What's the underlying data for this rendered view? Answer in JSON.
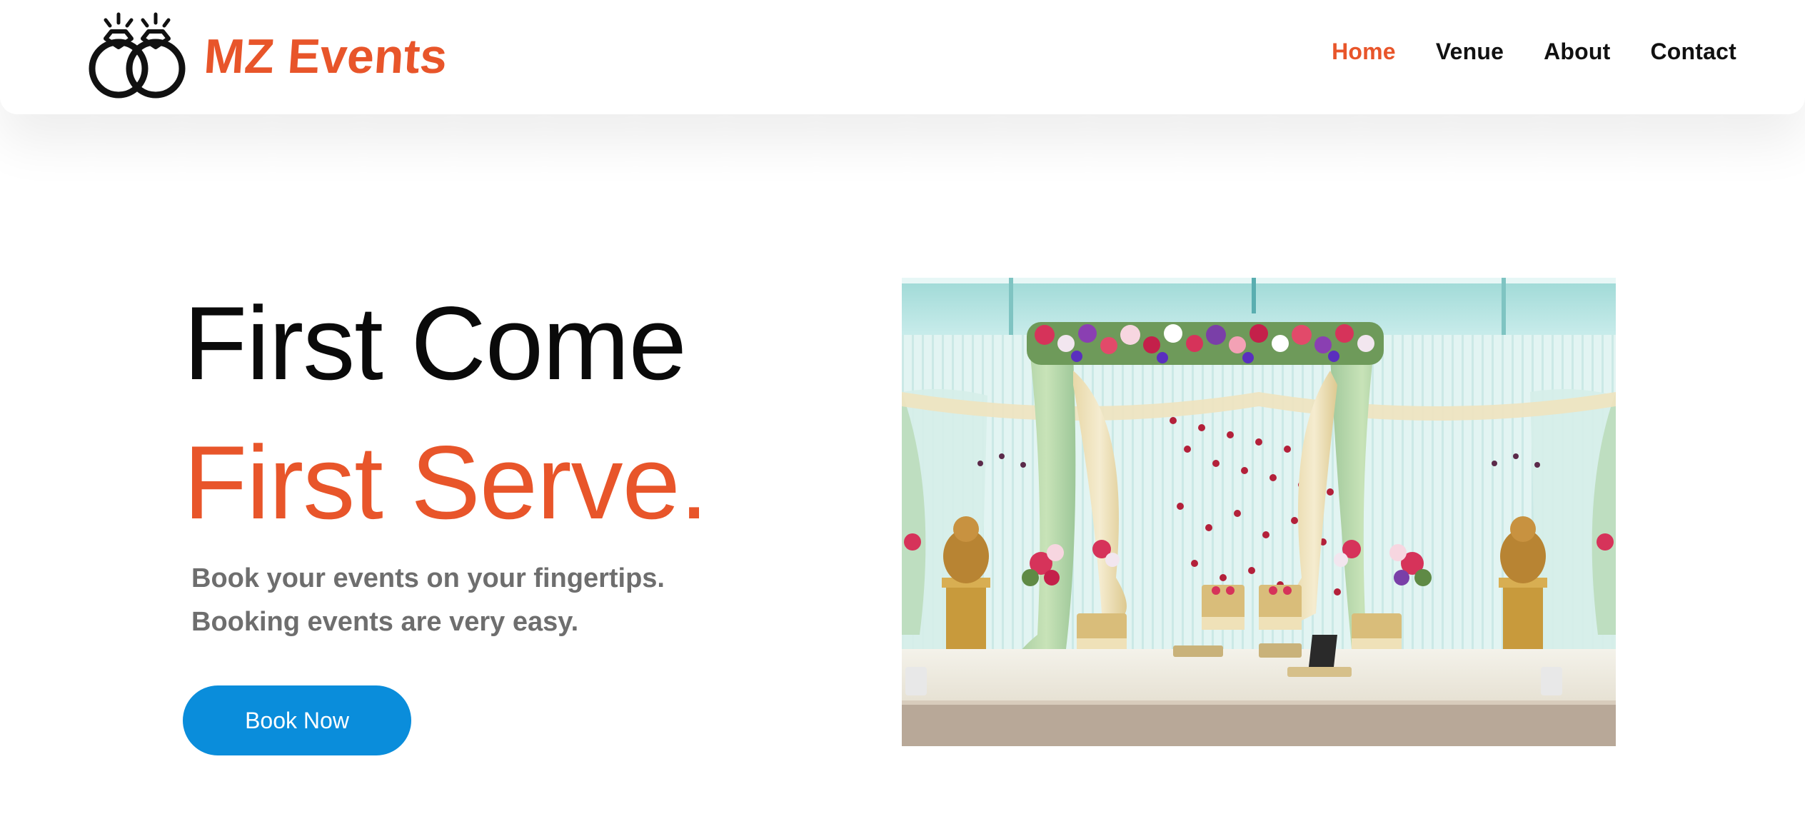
{
  "brand": {
    "name": "MZ Events",
    "logo_icon": "wedding-rings-icon",
    "accent_color": "#e8552a"
  },
  "nav": {
    "items": [
      {
        "label": "Home",
        "active": true
      },
      {
        "label": "Venue",
        "active": false
      },
      {
        "label": "About",
        "active": false
      },
      {
        "label": "Contact",
        "active": false
      }
    ]
  },
  "hero": {
    "title_line1": "First Come",
    "title_line2": "First Serve.",
    "subtitle_line1": "Book your events on your fingertips.",
    "subtitle_line2": "Booking events are very easy.",
    "cta_label": "Book Now",
    "cta_color": "#0a8ddb",
    "image_subject": "wedding-mandap-photo"
  }
}
